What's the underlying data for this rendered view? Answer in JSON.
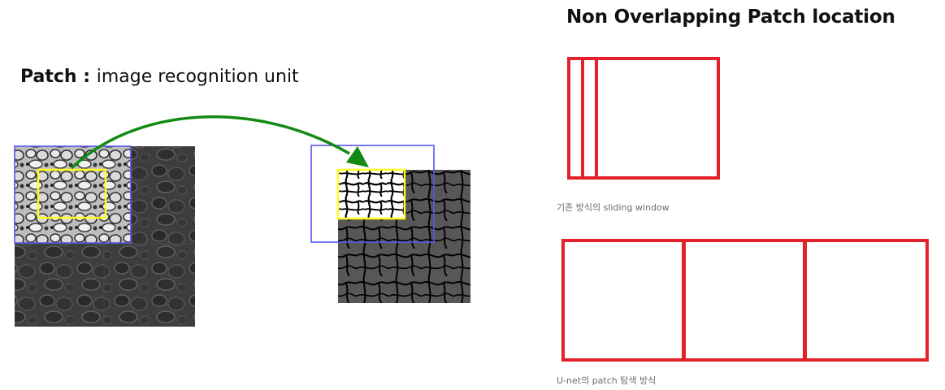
{
  "left": {
    "heading_bold": "Patch",
    "heading_sep": " : ",
    "heading_rest": "image recognition unit"
  },
  "right": {
    "title": "Non Overlapping Patch location",
    "caption_sliding": "기존 방식의 sliding window",
    "caption_unet": "U-net의 patch 탐색 방식"
  },
  "colors": {
    "patch_box": "#ffff22",
    "context_box": "#5555ee",
    "arrow": "#138a13",
    "window_red": "#e3212b",
    "micrograph_dark": "#3a3a3a",
    "segmentation_bg": "#555555"
  }
}
